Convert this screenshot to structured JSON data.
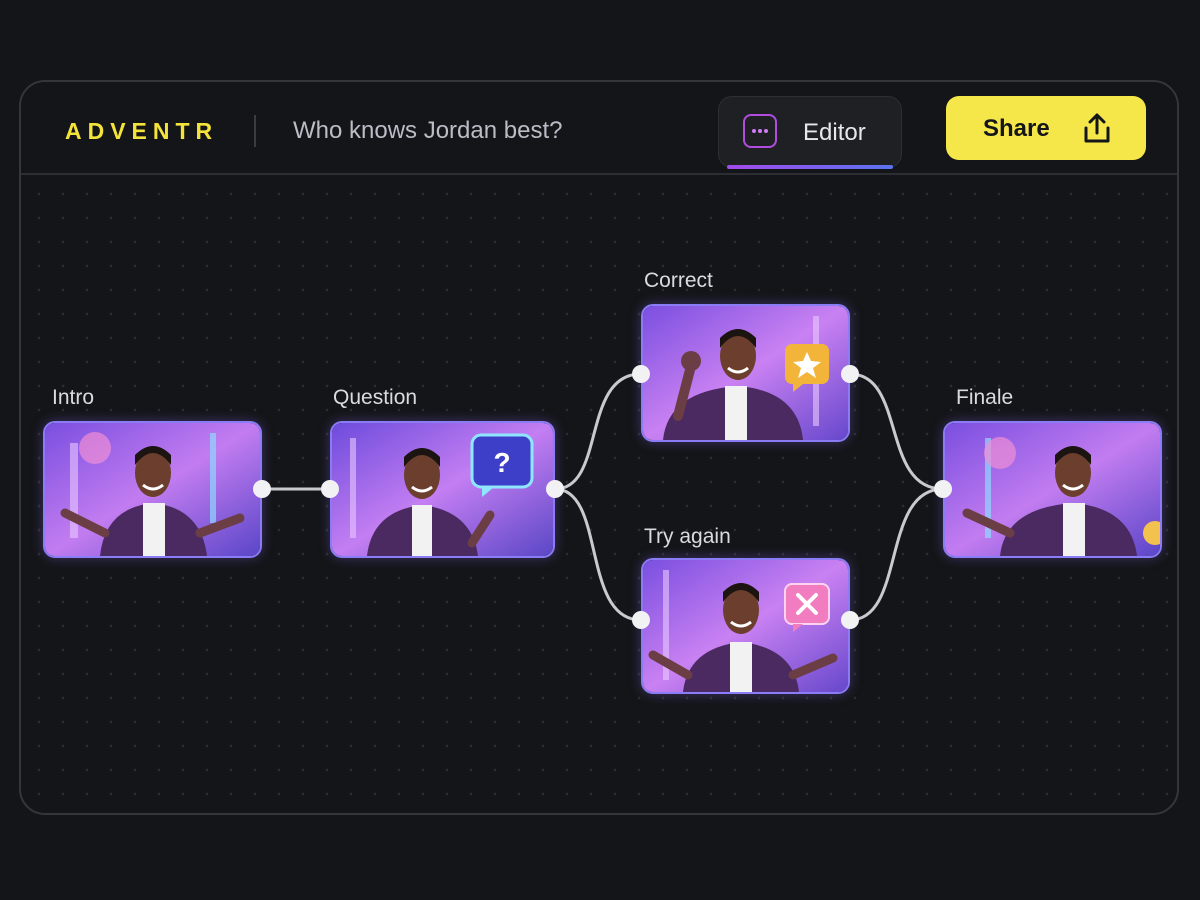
{
  "header": {
    "logo": "ADVENTR",
    "project_title": "Who knows Jordan best?",
    "editor_tab_label": "Editor",
    "share_label": "Share"
  },
  "nodes": [
    {
      "id": "intro",
      "label": "Intro",
      "badge": "none"
    },
    {
      "id": "question",
      "label": "Question",
      "badge": "question-bubble-icon"
    },
    {
      "id": "correct",
      "label": "Correct",
      "badge": "star-badge-icon"
    },
    {
      "id": "try_again",
      "label": "Try again",
      "badge": "x-badge-icon"
    },
    {
      "id": "finale",
      "label": "Finale",
      "badge": "none"
    }
  ],
  "connections": [
    [
      "intro",
      "question"
    ],
    [
      "question",
      "correct"
    ],
    [
      "question",
      "try_again"
    ],
    [
      "correct",
      "finale"
    ],
    [
      "try_again",
      "finale"
    ]
  ],
  "colors": {
    "brand_yellow": "#f5e64a",
    "accent_purple": "#b04ce0",
    "background": "#141518"
  }
}
